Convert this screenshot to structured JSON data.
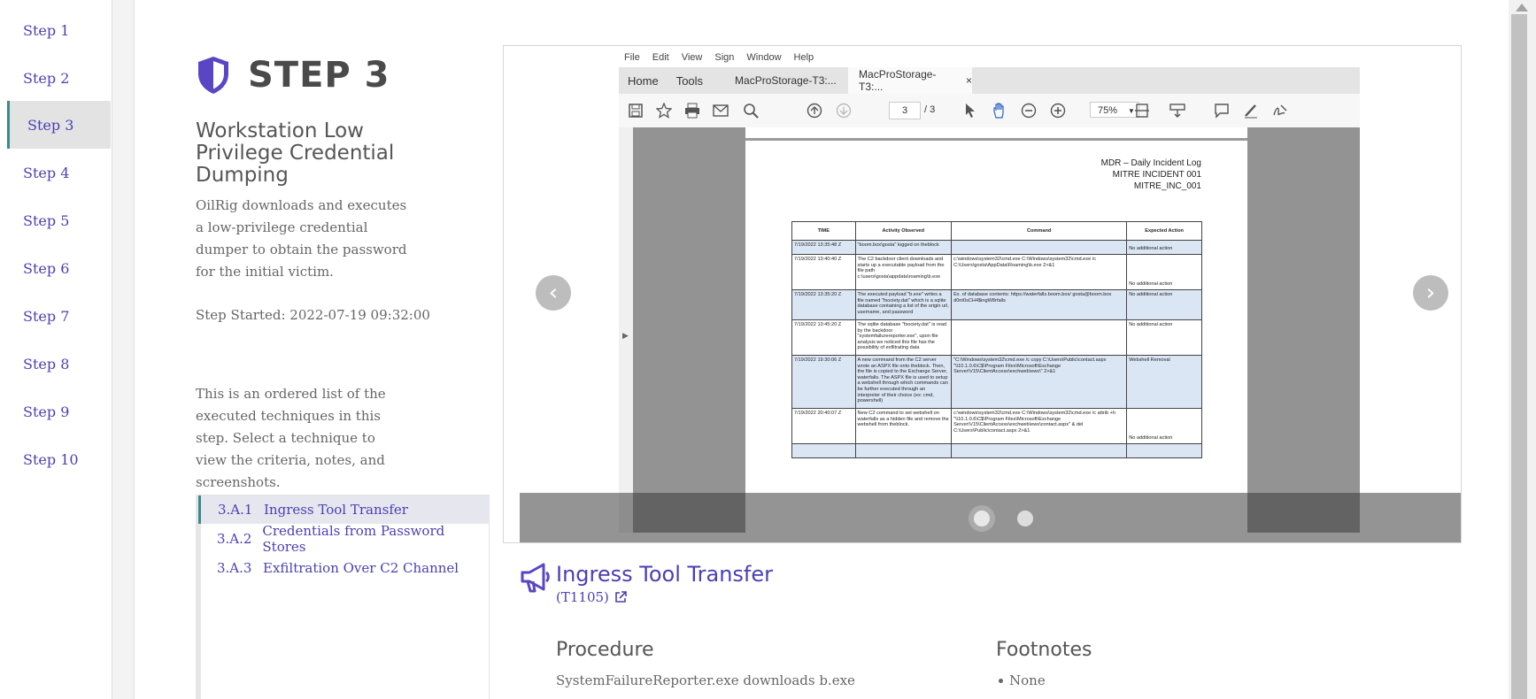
{
  "nav": {
    "items": [
      {
        "label": "Step 1"
      },
      {
        "label": "Step 2"
      },
      {
        "label": "Step 3"
      },
      {
        "label": "Step 4"
      },
      {
        "label": "Step 5"
      },
      {
        "label": "Step 6"
      },
      {
        "label": "Step 7"
      },
      {
        "label": "Step 8"
      },
      {
        "label": "Step 9"
      },
      {
        "label": "Step 10"
      }
    ],
    "active_index": 2
  },
  "step": {
    "title": "STEP 3",
    "subtitle": "Workstation Low Privilege Credential Dumping",
    "description": "OilRig downloads and executes a low-privilege credential dumper to obtain the password for the initial victim.",
    "started": "Step Started: 2022-07-19 09:32:00",
    "list_intro": "This is an ordered list of the executed techniques in this step. Select a technique to view the criteria, notes, and screenshots."
  },
  "techniques": [
    {
      "id": "3.A.1",
      "name": "Ingress Tool Transfer",
      "active": true
    },
    {
      "id": "3.A.2",
      "name": "Credentials from Password Stores",
      "active": false
    },
    {
      "id": "3.A.3",
      "name": "Exfiltration Over C2 Channel",
      "active": false
    }
  ],
  "screenshot": {
    "menu": [
      "File",
      "Edit",
      "View",
      "Sign",
      "Window",
      "Help"
    ],
    "tabs": {
      "home": "Home",
      "tools": "Tools",
      "doc1": "MacProStorage-T3:...",
      "doc2": "MacProStorage-T3:...",
      "close": "×"
    },
    "page_current": "3",
    "page_total": "/ 3",
    "zoom": "75%",
    "log_header": [
      "MDR – Daily Incident Log",
      "MITRE INCIDENT 001",
      "MITRE_INC_001"
    ],
    "table_headers": [
      "TIME",
      "Activity Observed",
      "Command",
      "Expected Action"
    ],
    "rows": [
      {
        "time": "7/19/2022 13:35:48 Z",
        "activity": "\"boom.box\\gosta\" logged on theblock",
        "command": "",
        "action": "No additional action",
        "hl": true
      },
      {
        "time": "7/19/2022 13:40:40 Z",
        "activity": "The C2 backdoor client downloads and starts up a executable payload from the file path c:\\users\\gosta\\appdata\\roaming\\b.exe",
        "command": "c:\\windows\\system32\\cmd.exe C:\\Windows\\system32\\cmd.exe /c C:\\Users\\gosta\\AppData\\Roaming\\b.exe 2>&1",
        "action": "No additional action",
        "hl": false
      },
      {
        "time": "7/19/2022 13:35:20 Z",
        "activity": "The executed payload \"b.exe\" writes a file named \"fsociety.dat\" which is a sqlite database containing a list of the origin url, username, and password",
        "command": "Ex. of database contents: https://waterfalls.boom.box/ gosta@boom.box d0nt0sCH4$ingW8rfalls",
        "action": "No additional action",
        "hl": true
      },
      {
        "time": "7/19/2022 13:45:20 Z",
        "activity": "The sqlite database \"fsociety.dat\" is read by the backdoor \"systemfailurereporter.exe\", upon file analysis we noticed this file has the possibility of exfiltrating data",
        "command": "",
        "action": "No additional action",
        "hl": false
      },
      {
        "time": "7/19/2022 19:30:06 Z",
        "activity": "A new command from the C2 server wrote an ASPX file onto theblock. Then, the file is copied to the Exchange Server, waterfalls. The ASPX file is used to setup a webshell through which commands can be further executed through an interpreter of their choice (ex: cmd, powershell)",
        "command": "\"C:\\Windows\\system32\\cmd.exe /c copy C:\\Users\\Public\\contact.aspx \"\\\\10.1.0.6\\C$\\Program Files\\Microsoft\\Exchange Server\\V15\\ClientAccess\\exchweb\\ews\\\" 2>&1",
        "action": "Webshell Removal",
        "hl": true
      },
      {
        "time": "7/19/2022 20:40:07 Z",
        "activity": "New C2 command to set webshell on waterfalls as a hidden file and remove the webshell from theblock.",
        "command": "c:\\windows\\system32\\cmd.exe C:\\Windows\\system32\\cmd.exe /c attrib +h \"\\\\10.1.0.6\\C$\\Program Files\\Microsoft\\Exchange Server\\V15\\ClientAccess\\exchweb\\ews\\contact.aspx\" & del C:\\Users\\Public\\contact.aspx 2>&1",
        "action": "No additional action",
        "hl": false
      },
      {
        "time": "",
        "activity": "",
        "command": "",
        "action": "",
        "hl": true
      }
    ],
    "prev_arrow": "‹",
    "next_arrow": "›",
    "slide_count": 2,
    "active_slide": 0
  },
  "detail": {
    "title": "Ingress Tool Transfer",
    "technique_id": "(T1105)",
    "procedure_heading": "Procedure",
    "procedure_text": "SystemFailureReporter.exe downloads b.exe",
    "footnotes_heading": "Footnotes",
    "footnotes": [
      "None"
    ]
  },
  "colors": {
    "accent": "#4a3fb5",
    "teal": "#3a8c8c"
  }
}
